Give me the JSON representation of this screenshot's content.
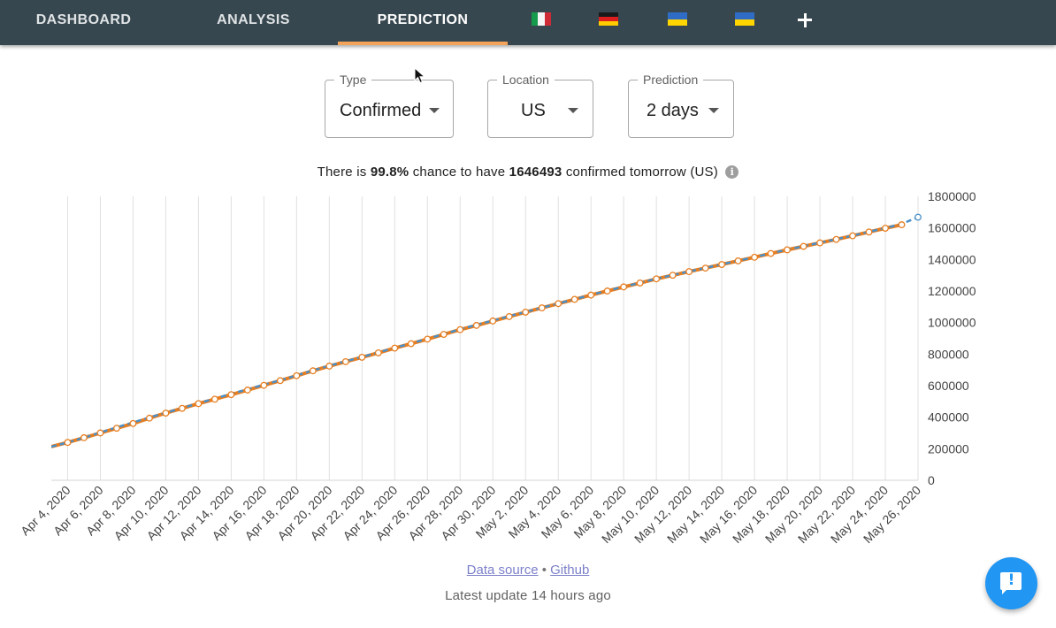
{
  "nav": {
    "tabs": [
      {
        "label": "DASHBOARD",
        "active": false
      },
      {
        "label": "ANALYSIS",
        "active": false
      },
      {
        "label": "PREDICTION",
        "active": true
      }
    ],
    "flags": [
      "italy-flag",
      "germany-flag",
      "ukraine-flag",
      "ukraine-flag"
    ],
    "add_icon": "plus-icon",
    "accent_color": "#f3a35a",
    "bar_color": "#37474f"
  },
  "controls": {
    "type": {
      "legend": "Type",
      "value": "Confirmed"
    },
    "location": {
      "legend": "Location",
      "value": "US"
    },
    "prediction": {
      "legend": "Prediction",
      "value": "2 days"
    }
  },
  "headline": {
    "prefix": "There is",
    "chance": "99.8%",
    "middle": "chance to have",
    "count": "1646493",
    "suffix": "confirmed tomorrow (US)",
    "info_icon": "info-icon"
  },
  "chart_data": {
    "type": "line",
    "xlabel": "",
    "ylabel": "",
    "ylim": [
      0,
      1800000
    ],
    "yticks": [
      "1800000",
      "1600000",
      "1400000",
      "1200000",
      "1000000",
      "800000",
      "600000",
      "400000",
      "200000",
      "0"
    ],
    "xticks": [
      "Apr 4, 2020",
      "Apr 6, 2020",
      "Apr 8, 2020",
      "Apr 10, 2020",
      "Apr 12, 2020",
      "Apr 14, 2020",
      "Apr 16, 2020",
      "Apr 18, 2020",
      "Apr 20, 2020",
      "Apr 22, 2020",
      "Apr 24, 2020",
      "Apr 26, 2020",
      "Apr 28, 2020",
      "Apr 30, 2020",
      "May 2, 2020",
      "May 4, 2020",
      "May 6, 2020",
      "May 8, 2020",
      "May 10, 2020",
      "May 12, 2020",
      "May 14, 2020",
      "May 16, 2020",
      "May 18, 2020",
      "May 20, 2020",
      "May 22, 2020",
      "May 24, 2020",
      "May 26, 2020"
    ],
    "grid": true,
    "y_axis_side": "right",
    "x": [
      "Apr 3, 2020",
      "Apr 4, 2020",
      "Apr 5, 2020",
      "Apr 6, 2020",
      "Apr 7, 2020",
      "Apr 8, 2020",
      "Apr 9, 2020",
      "Apr 10, 2020",
      "Apr 11, 2020",
      "Apr 12, 2020",
      "Apr 13, 2020",
      "Apr 14, 2020",
      "Apr 15, 2020",
      "Apr 16, 2020",
      "Apr 17, 2020",
      "Apr 18, 2020",
      "Apr 19, 2020",
      "Apr 20, 2020",
      "Apr 21, 2020",
      "Apr 22, 2020",
      "Apr 23, 2020",
      "Apr 24, 2020",
      "Apr 25, 2020",
      "Apr 26, 2020",
      "Apr 27, 2020",
      "Apr 28, 2020",
      "Apr 29, 2020",
      "Apr 30, 2020",
      "May 1, 2020",
      "May 2, 2020",
      "May 3, 2020",
      "May 4, 2020",
      "May 5, 2020",
      "May 6, 2020",
      "May 7, 2020",
      "May 8, 2020",
      "May 9, 2020",
      "May 10, 2020",
      "May 11, 2020",
      "May 12, 2020",
      "May 13, 2020",
      "May 14, 2020",
      "May 15, 2020",
      "May 16, 2020",
      "May 17, 2020",
      "May 18, 2020",
      "May 19, 2020",
      "May 20, 2020",
      "May 21, 2020",
      "May 22, 2020",
      "May 23, 2020",
      "May 24, 2020",
      "May 25, 2020",
      "May 26, 2020"
    ],
    "series": [
      {
        "color": "#e67e22",
        "values": [
          213000,
          240000,
          270000,
          300000,
          330000,
          360000,
          394000,
          426000,
          456000,
          486000,
          514000,
          543000,
          572000,
          602000,
          632000,
          663000,
          694000,
          724000,
          752000,
          780000,
          808000,
          838000,
          866000,
          895000,
          925000,
          955000,
          982000,
          1010000,
          1038000,
          1066000,
          1093000,
          1120000,
          1147000,
          1174000,
          1200000,
          1226000,
          1251000,
          1277000,
          1300000,
          1323000,
          1345000,
          1368000,
          1391000,
          1414000,
          1438000,
          1461000,
          1483000,
          1505000,
          1527000,
          1550000,
          1574000,
          1598000,
          1620000,
          null
        ]
      },
      {
        "color": "#4a90c8",
        "dashed": true,
        "values": [
          213000,
          240000,
          270000,
          303000,
          336000,
          367000,
          398000,
          428000,
          458000,
          488000,
          518000,
          548000,
          577000,
          606000,
          634000,
          665000,
          696000,
          726000,
          754000,
          782000,
          810000,
          840000,
          868000,
          897000,
          927000,
          958000,
          986000,
          1012000,
          1040000,
          1067000,
          1094000,
          1121000,
          1148000,
          1175000,
          1202000,
          1227000,
          1252000,
          1278000,
          1301000,
          1324000,
          1346000,
          1369000,
          1392000,
          1415000,
          1439000,
          1462000,
          1484000,
          1506000,
          1528000,
          1551000,
          1575000,
          1599000,
          1625000,
          1668000
        ]
      }
    ]
  },
  "footer": {
    "data_source": "Data source",
    "separator": "•",
    "github": "Github",
    "update": "Latest update 14 hours ago",
    "feedback_icon": "feedback-icon"
  }
}
